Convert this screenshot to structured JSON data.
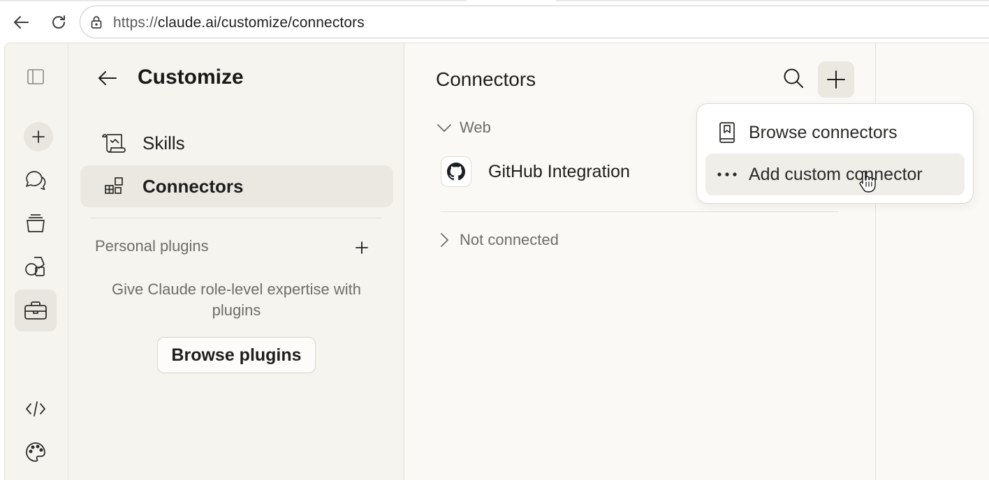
{
  "browser": {
    "url_scheme": "https://",
    "url_rest": "claude.ai/customize/connectors"
  },
  "rail": {
    "items": [
      "sidebar-toggle",
      "new-chat",
      "chats",
      "projects",
      "artifacts",
      "customize",
      "code",
      "palette"
    ],
    "active": "customize"
  },
  "customize": {
    "title": "Customize",
    "nav": [
      {
        "label": "Skills",
        "icon": "scroll-icon",
        "active": false
      },
      {
        "label": "Connectors",
        "icon": "blocks-icon",
        "active": true
      }
    ],
    "plugins_heading": "Personal plugins",
    "plugins_description": "Give Claude role-level expertise with plugins",
    "browse_plugins_label": "Browse plugins"
  },
  "connectors": {
    "title": "Connectors",
    "groups": [
      {
        "label": "Web",
        "expanded": true,
        "items": [
          {
            "name": "GitHub Integration",
            "icon": "github-icon"
          }
        ]
      },
      {
        "label": "Not connected",
        "expanded": false,
        "items": []
      }
    ]
  },
  "add_menu": {
    "items": [
      {
        "label": "Browse connectors",
        "icon": "book-icon",
        "hovered": false
      },
      {
        "label": "Add custom connector",
        "icon": "more-dots-icon",
        "hovered": true
      }
    ]
  },
  "colors": {
    "page_bg": "#faf9f5",
    "sidebar_bg": "#f5f4ef",
    "active_bg": "#eae8e1",
    "text": "#1f1e1d",
    "muted_text": "#6f6d68"
  }
}
